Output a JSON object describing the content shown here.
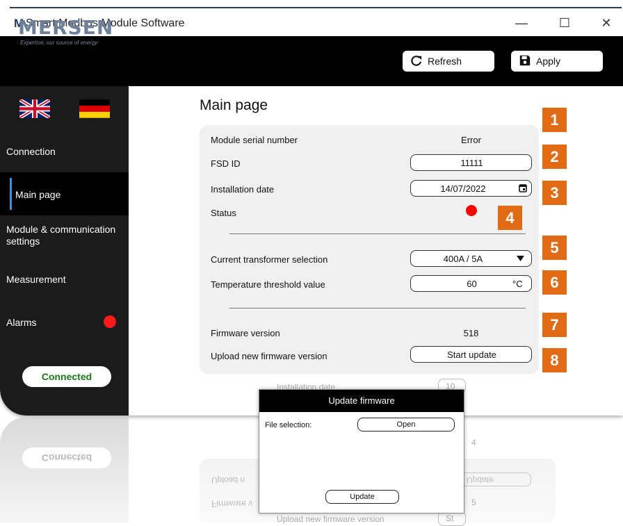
{
  "window": {
    "logo_mark": "M",
    "title": "Smart Modbus Module Software",
    "minimize": "—",
    "maximize": "☐",
    "close": "✕"
  },
  "header": {
    "brand": "MERSEN",
    "tagline": "Expertise, our source of energy",
    "refresh_label": "Refresh",
    "refresh_icon": "refresh-icon",
    "apply_label": "Apply",
    "apply_icon": "save-icon"
  },
  "sidebar": {
    "flags": [
      "uk-flag-icon",
      "germany-flag-icon"
    ],
    "items": [
      {
        "label": "Connection"
      },
      {
        "label": "Main page",
        "active": true
      },
      {
        "label": "Module & communication"
      },
      {
        "label": "settings"
      },
      {
        "label": "Measurement"
      },
      {
        "label": "Alarms",
        "alarm": true
      }
    ],
    "connection_status": "Connected",
    "status_color": "#1a7a1a",
    "alarm_color": "#ff1a1a"
  },
  "main": {
    "title": "Main page",
    "rows": {
      "serial_label": "Module serial number",
      "serial_value": "Error",
      "fsd_label": "FSD ID",
      "fsd_value": "11111",
      "install_label": "Installation date",
      "install_value": "14/07/2022",
      "status_label": "Status",
      "ct_label": "Current transformer selection",
      "ct_value": "400A / 5A",
      "temp_label": "Temperature threshold value",
      "temp_value": "60",
      "temp_unit": "°C",
      "fw_label": "Firmware version",
      "fw_value": "518",
      "upload_label": "Upload new firmware version",
      "upload_button": "Start update"
    },
    "status_color": "#ff0000",
    "badges": [
      "1",
      "2",
      "3",
      "4",
      "5",
      "6",
      "7",
      "8"
    ],
    "badge_color": "#e06b14"
  },
  "ghost": {
    "install_label": "Installation date",
    "install_value": "10",
    "extra_value": "4",
    "upload_label": "Upload new firmware version",
    "upload_value": "St",
    "fw_value": "5"
  },
  "reflection": {
    "connected": "Connected",
    "upload_label": "Upload n",
    "firmware_label": "Firmware v",
    "button": "Update"
  },
  "modal": {
    "title": "Update firmware",
    "file_label": "File selection:",
    "open_button": "Open",
    "update_button": "Update"
  }
}
